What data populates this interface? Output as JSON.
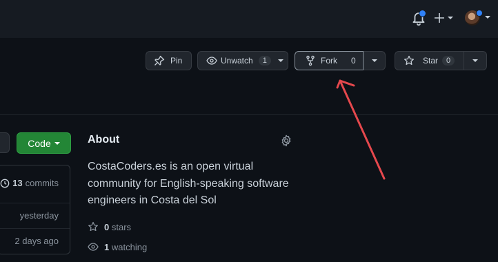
{
  "header": {
    "icons": [
      "bell-icon",
      "plus-icon",
      "avatar"
    ]
  },
  "repo_actions": {
    "pin_label": "Pin",
    "unwatch_label": "Unwatch",
    "watch_count": "1",
    "fork_label": "Fork",
    "fork_count": "0",
    "star_label": "Star",
    "star_count": "0"
  },
  "code_button": {
    "label": "Code"
  },
  "files": {
    "commit_count": "13",
    "commits_label": "commits",
    "rows": [
      "yesterday",
      "2 days ago"
    ]
  },
  "about": {
    "title": "About",
    "description": "CostaCoders.es is an open virtual community for English-speaking software engineers in Costa del Sol",
    "stars_count": "0",
    "stars_label": "stars",
    "watching_count": "1",
    "watching_label": "watching"
  },
  "annotation": {
    "color": "#e5484d"
  },
  "colors": {
    "background": "#0d1117",
    "header": "#161b22",
    "accent_green": "#238636",
    "notification_blue": "#2f81f7"
  }
}
